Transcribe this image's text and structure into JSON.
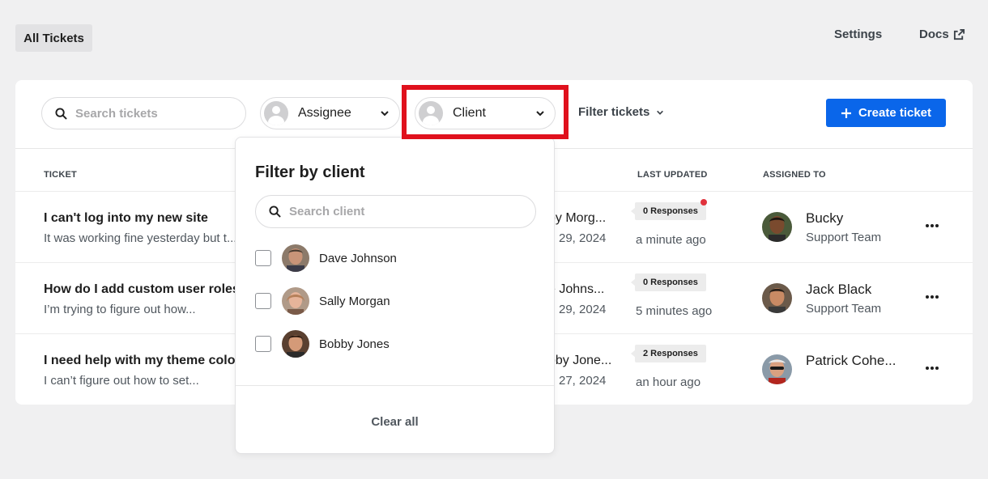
{
  "top": {
    "tab_label": "All Tickets",
    "settings_label": "Settings",
    "docs_label": "Docs"
  },
  "toolbar": {
    "search_placeholder": "Search tickets",
    "assignee_label": "Assignee",
    "client_label": "Client",
    "filter_label": "Filter tickets",
    "create_label": "Create ticket"
  },
  "table": {
    "headers": [
      "TICKET",
      "LAST UPDATED",
      "ASSIGNED TO"
    ],
    "rows": [
      {
        "title": "I can't log into my new site",
        "excerpt": "It was working fine yesterday but t...",
        "client": "by Morg...",
        "date": "29, 2024",
        "responses": "0 Responses",
        "unread": true,
        "updated": "a minute ago",
        "assignee": "Bucky",
        "team": "Support Team"
      },
      {
        "title": "How do I add custom user roles",
        "excerpt": "I’m trying to figure out how...",
        "client": "e Johns...",
        "date": "29, 2024",
        "responses": "0 Responses",
        "unread": false,
        "updated": "5 minutes ago",
        "assignee": "Jack Black",
        "team": "Support Team"
      },
      {
        "title": "I need help with my theme colors",
        "excerpt": "I can’t figure out how to set...",
        "client": "bby Jone...",
        "date": "27, 2024",
        "responses": "2 Responses",
        "unread": false,
        "updated": "an hour ago",
        "assignee": "Patrick Cohe...",
        "team": ""
      }
    ]
  },
  "dropdown": {
    "title": "Filter by client",
    "search_placeholder": "Search client",
    "clients": [
      "Dave Johnson",
      "Sally Morgan",
      "Bobby Jones"
    ],
    "clear_label": "Clear all"
  },
  "colors": {
    "accent": "#0a66ea",
    "highlight": "#e0111d",
    "unread_dot": "#e0323c"
  }
}
